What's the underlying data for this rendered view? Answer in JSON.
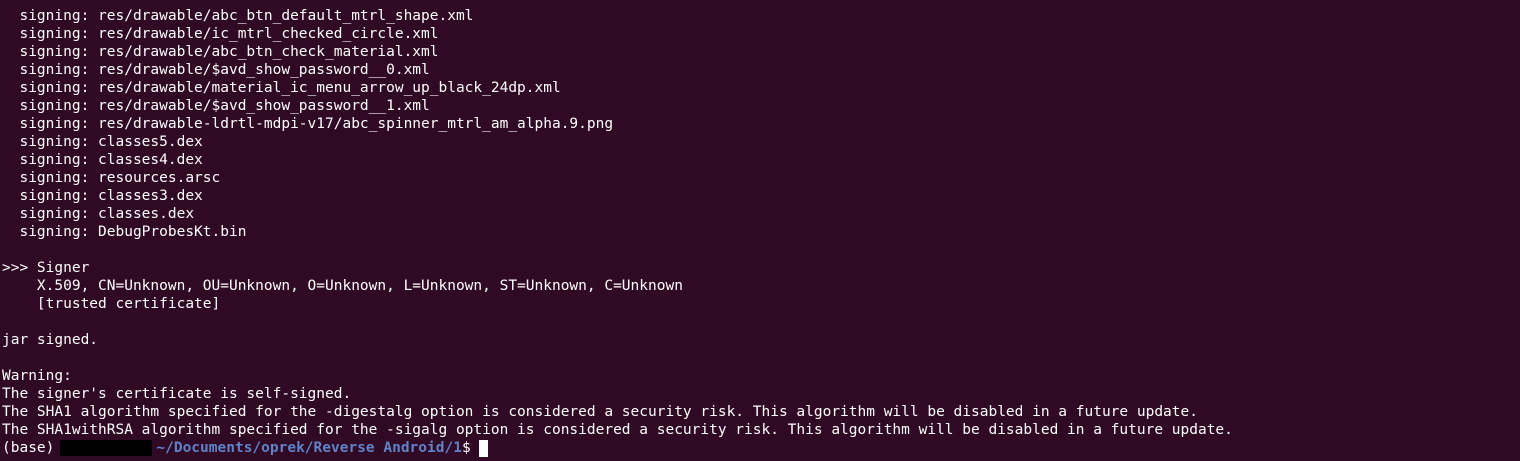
{
  "terminal": {
    "lines": [
      "  signing: res/drawable/abc_btn_default_mtrl_shape.xml",
      "  signing: res/drawable/ic_mtrl_checked_circle.xml",
      "  signing: res/drawable/abc_btn_check_material.xml",
      "  signing: res/drawable/$avd_show_password__0.xml",
      "  signing: res/drawable/material_ic_menu_arrow_up_black_24dp.xml",
      "  signing: res/drawable/$avd_show_password__1.xml",
      "  signing: res/drawable-ldrtl-mdpi-v17/abc_spinner_mtrl_am_alpha.9.png",
      "  signing: classes5.dex",
      "  signing: classes4.dex",
      "  signing: resources.arsc",
      "  signing: classes3.dex",
      "  signing: classes.dex",
      "  signing: DebugProbesKt.bin",
      "",
      ">>> Signer",
      "    X.509, CN=Unknown, OU=Unknown, O=Unknown, L=Unknown, ST=Unknown, C=Unknown",
      "    [trusted certificate]",
      "",
      "jar signed.",
      "",
      "Warning:",
      "The signer's certificate is self-signed.",
      "The SHA1 algorithm specified for the -digestalg option is considered a security risk. This algorithm will be disabled in a future update.",
      "The SHA1withRSA algorithm specified for the -sigalg option is considered a security risk. This algorithm will be disabled in a future update."
    ],
    "prompt": {
      "env": "(base)",
      "path": "~/Documents/oprek/Reverse Android/1",
      "symbol": "$"
    },
    "colors": {
      "background": "#300a24",
      "text": "#ffffff",
      "path": "#5e83c8"
    }
  }
}
